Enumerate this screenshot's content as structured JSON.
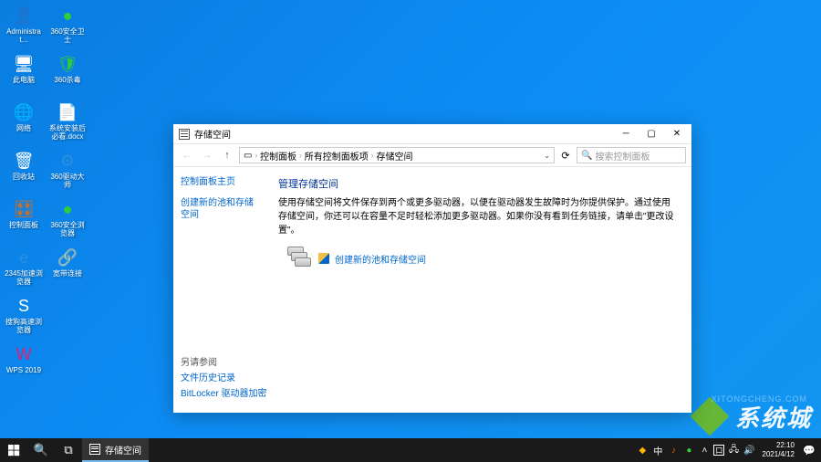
{
  "desktop_icons": [
    {
      "name": "administrator",
      "label": "Administrat...",
      "glyph": "👤",
      "color": "#fff"
    },
    {
      "name": "360-safe",
      "label": "360安全卫士",
      "glyph": "●",
      "color": "#3c3"
    },
    {
      "name": "this-pc",
      "label": "此电脑",
      "glyph": "🖥",
      "color": "#fff"
    },
    {
      "name": "360-shadu",
      "label": "360杀毒",
      "glyph": "🛡",
      "color": "#3c3"
    },
    {
      "name": "network",
      "label": "网络",
      "glyph": "🌐",
      "color": "#fff"
    },
    {
      "name": "docx",
      "label": "系统安装后必看.docx",
      "glyph": "📄",
      "color": "#2a5caa"
    },
    {
      "name": "recycle",
      "label": "回收站",
      "glyph": "🗑",
      "color": "#fff"
    },
    {
      "name": "360-driver",
      "label": "360驱动大师",
      "glyph": "⚙",
      "color": "#2a90e0"
    },
    {
      "name": "ctrl-panel",
      "label": "控制面板",
      "glyph": "🎛",
      "color": "#e86c0a"
    },
    {
      "name": "360-browser",
      "label": "360安全浏览器",
      "glyph": "●",
      "color": "#3c3"
    },
    {
      "name": "ie",
      "label": "2345加速浏览器",
      "glyph": "e",
      "color": "#2a90e0"
    },
    {
      "name": "broadband",
      "label": "宽带连接",
      "glyph": "🔗",
      "color": "#fff"
    },
    {
      "name": "sogou",
      "label": "搜狗高速浏览器",
      "glyph": "S",
      "color": "#fff"
    },
    {
      "name": "empty1",
      "label": "",
      "glyph": "",
      "color": ""
    },
    {
      "name": "wps",
      "label": "WPS 2019",
      "glyph": "W",
      "color": "#d4237a"
    }
  ],
  "window": {
    "title": "存储空间",
    "breadcrumb": [
      "控制面板",
      "所有控制面板项",
      "存储空间"
    ],
    "search_placeholder": "搜索控制面板",
    "sidebar": {
      "home": "控制面板主页",
      "create": "创建新的池和存储空间"
    },
    "content": {
      "heading": "管理存储空间",
      "description": "使用存储空间将文件保存到两个或更多驱动器，以便在驱动器发生故障时为你提供保护。通过使用存储空间，你还可以在容量不足时轻松添加更多驱动器。如果你没有看到任务链接，请单击\"更改设置\"。",
      "action_link": "创建新的池和存储空间"
    },
    "seealso": {
      "header": "另请参阅",
      "items": [
        "文件历史记录",
        "BitLocker 驱动器加密"
      ]
    }
  },
  "taskbar": {
    "active_task": "存储空间"
  },
  "clock": {
    "time": "22:10",
    "date": "2021/4/12"
  },
  "watermark": {
    "text": "系统城",
    "url": "XITONGCHENG.COM"
  }
}
